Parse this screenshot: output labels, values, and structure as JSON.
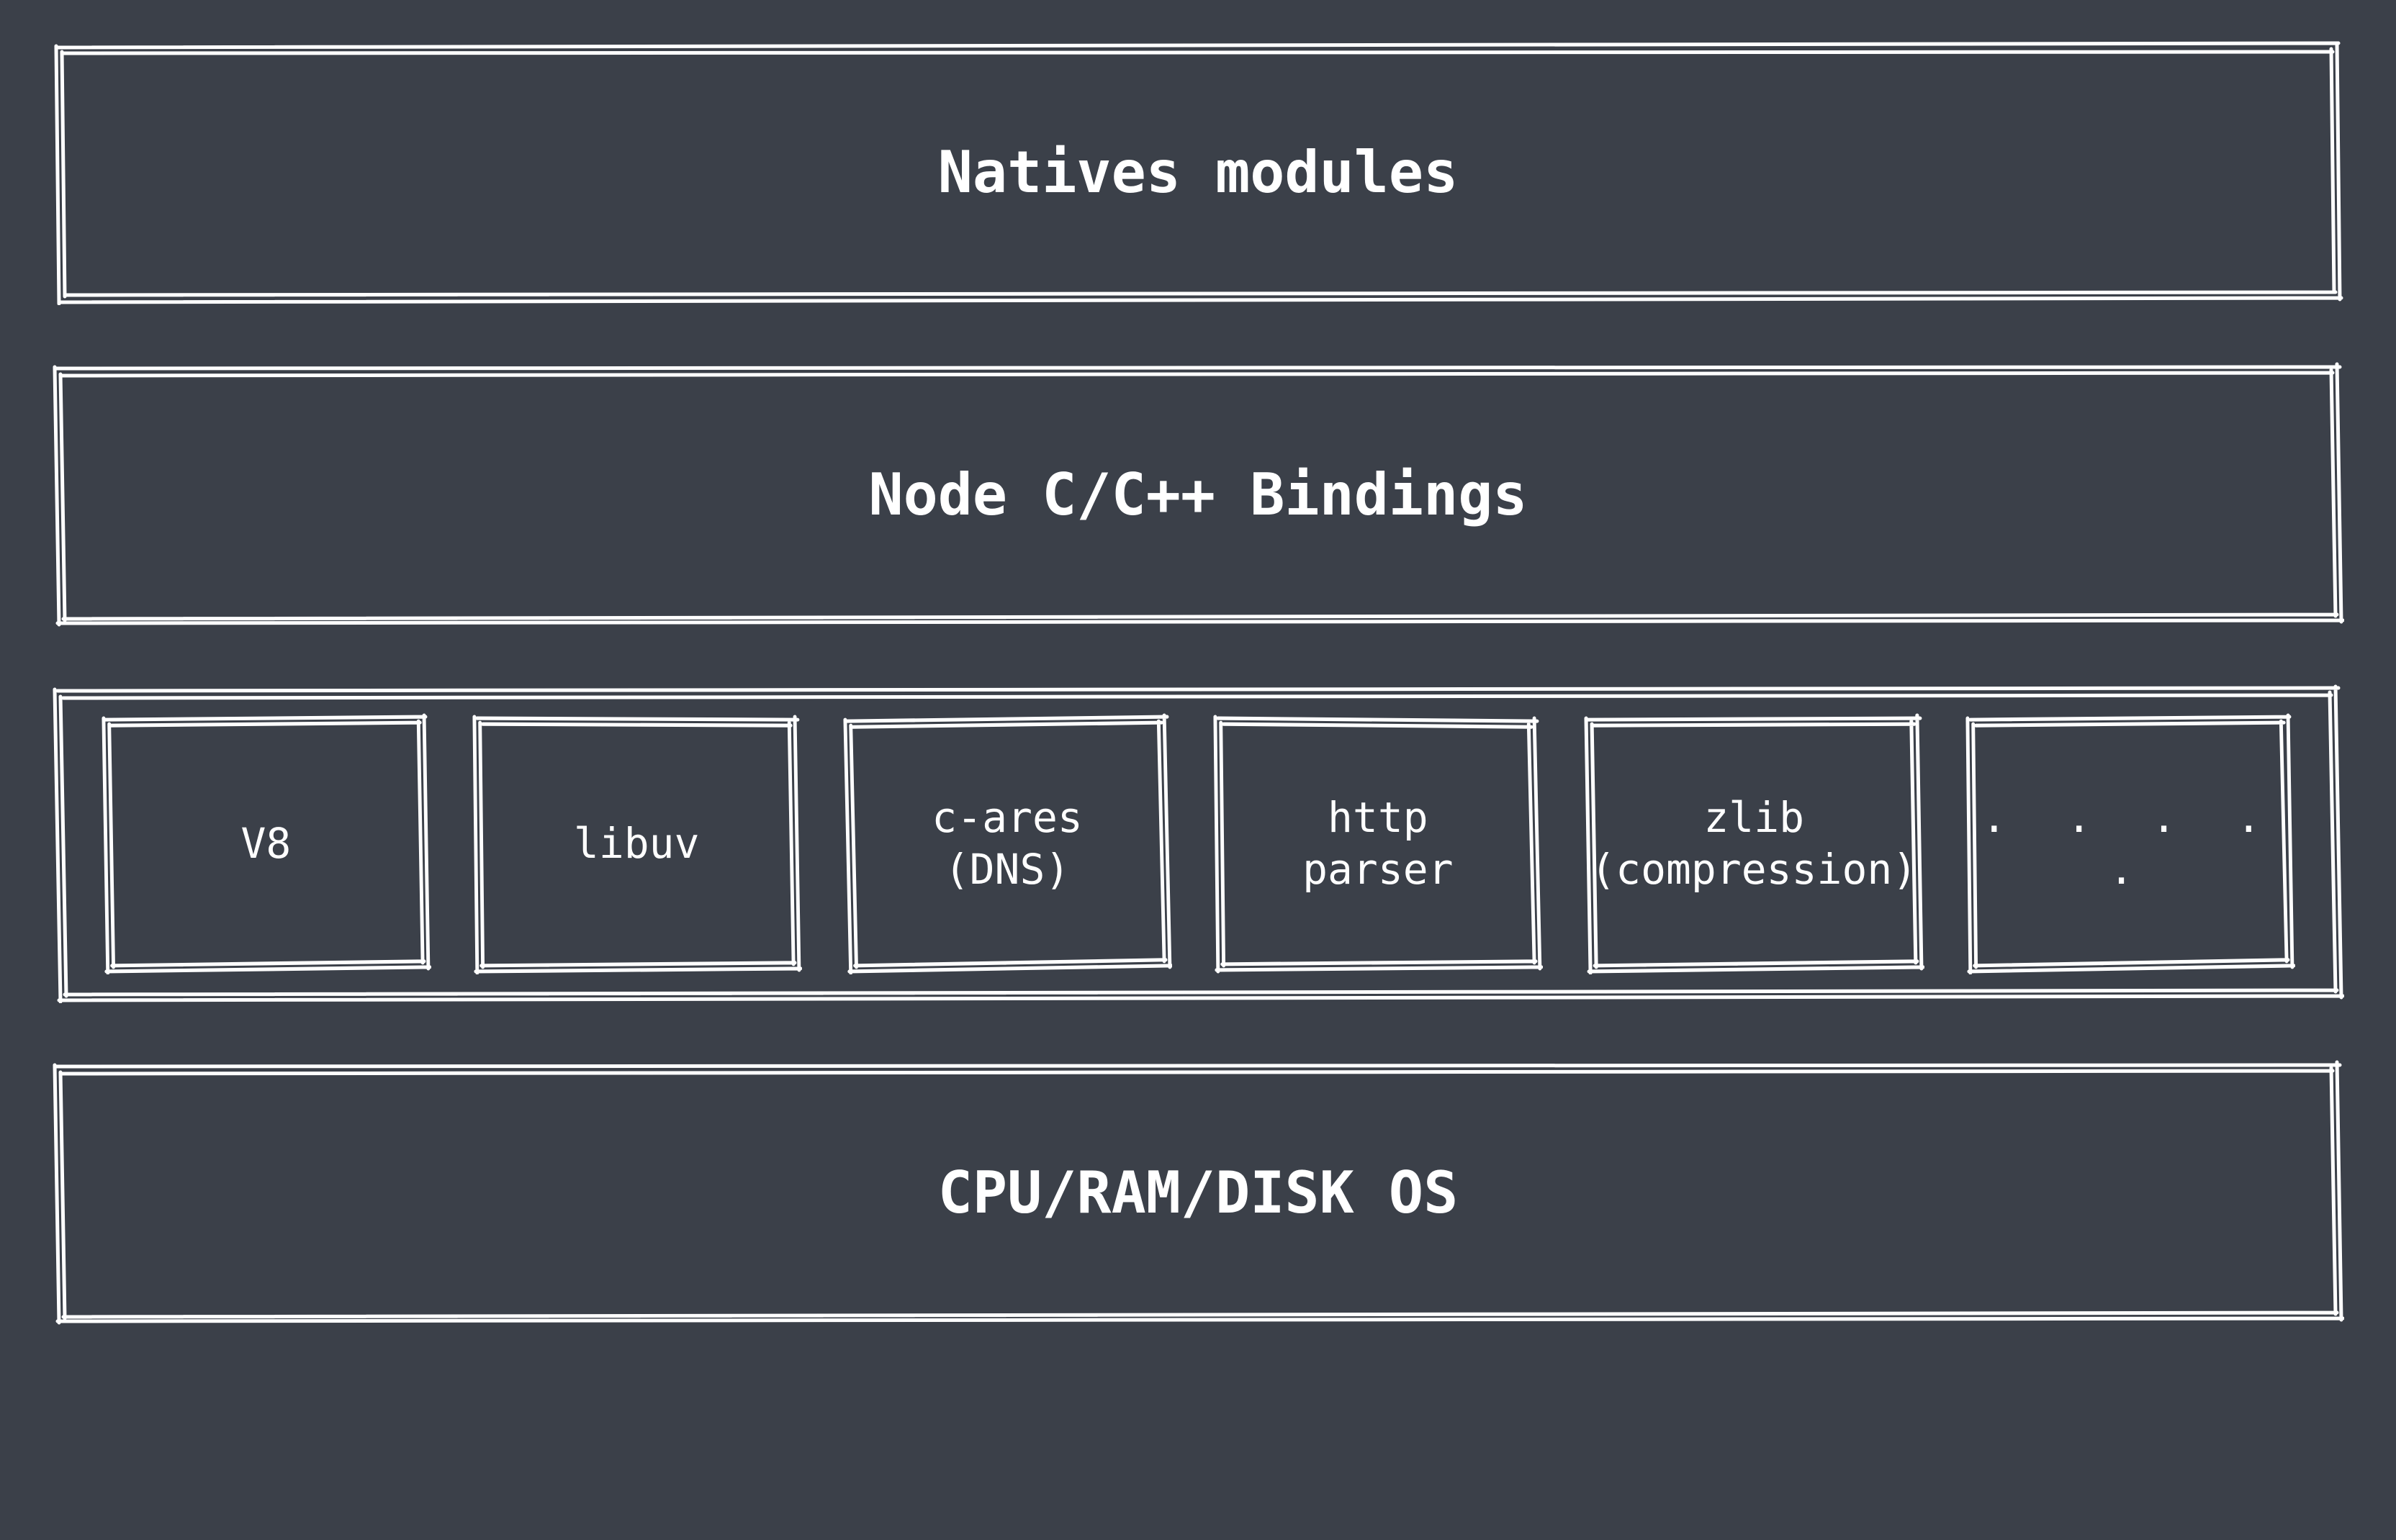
{
  "layers": {
    "natives": {
      "label": "Natives modules"
    },
    "bindings": {
      "label": "Node C/C++ Bindings"
    },
    "libs_container": {
      "label": ""
    },
    "os": {
      "label": "CPU/RAM/DISK OS"
    }
  },
  "libs": [
    {
      "label": "V8"
    },
    {
      "label": "libuv"
    },
    {
      "label": "c-ares\n(DNS)"
    },
    {
      "label": "http\nparser"
    },
    {
      "label": "zlib\n(compression)"
    },
    {
      "label": ". . . . ."
    }
  ]
}
